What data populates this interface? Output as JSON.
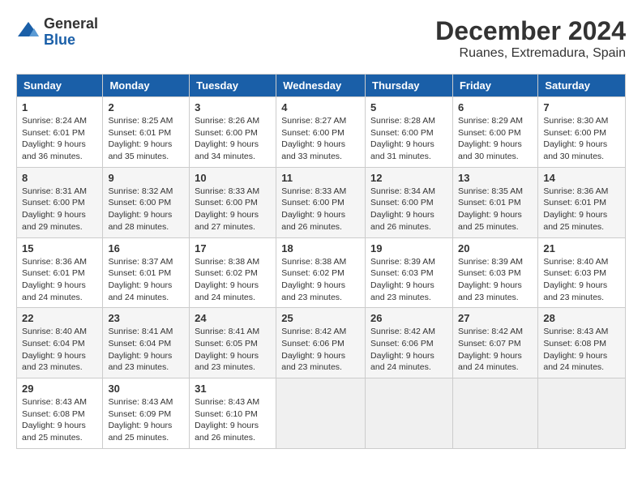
{
  "logo": {
    "general": "General",
    "blue": "Blue"
  },
  "title": {
    "month": "December 2024",
    "location": "Ruanes, Extremadura, Spain"
  },
  "headers": [
    "Sunday",
    "Monday",
    "Tuesday",
    "Wednesday",
    "Thursday",
    "Friday",
    "Saturday"
  ],
  "weeks": [
    [
      {
        "day": "1",
        "sunrise": "8:24 AM",
        "sunset": "6:01 PM",
        "daylight": "9 hours and 36 minutes."
      },
      {
        "day": "2",
        "sunrise": "8:25 AM",
        "sunset": "6:01 PM",
        "daylight": "9 hours and 35 minutes."
      },
      {
        "day": "3",
        "sunrise": "8:26 AM",
        "sunset": "6:00 PM",
        "daylight": "9 hours and 34 minutes."
      },
      {
        "day": "4",
        "sunrise": "8:27 AM",
        "sunset": "6:00 PM",
        "daylight": "9 hours and 33 minutes."
      },
      {
        "day": "5",
        "sunrise": "8:28 AM",
        "sunset": "6:00 PM",
        "daylight": "9 hours and 31 minutes."
      },
      {
        "day": "6",
        "sunrise": "8:29 AM",
        "sunset": "6:00 PM",
        "daylight": "9 hours and 30 minutes."
      },
      {
        "day": "7",
        "sunrise": "8:30 AM",
        "sunset": "6:00 PM",
        "daylight": "9 hours and 30 minutes."
      }
    ],
    [
      {
        "day": "8",
        "sunrise": "8:31 AM",
        "sunset": "6:00 PM",
        "daylight": "9 hours and 29 minutes."
      },
      {
        "day": "9",
        "sunrise": "8:32 AM",
        "sunset": "6:00 PM",
        "daylight": "9 hours and 28 minutes."
      },
      {
        "day": "10",
        "sunrise": "8:33 AM",
        "sunset": "6:00 PM",
        "daylight": "9 hours and 27 minutes."
      },
      {
        "day": "11",
        "sunrise": "8:33 AM",
        "sunset": "6:00 PM",
        "daylight": "9 hours and 26 minutes."
      },
      {
        "day": "12",
        "sunrise": "8:34 AM",
        "sunset": "6:00 PM",
        "daylight": "9 hours and 26 minutes."
      },
      {
        "day": "13",
        "sunrise": "8:35 AM",
        "sunset": "6:01 PM",
        "daylight": "9 hours and 25 minutes."
      },
      {
        "day": "14",
        "sunrise": "8:36 AM",
        "sunset": "6:01 PM",
        "daylight": "9 hours and 25 minutes."
      }
    ],
    [
      {
        "day": "15",
        "sunrise": "8:36 AM",
        "sunset": "6:01 PM",
        "daylight": "9 hours and 24 minutes."
      },
      {
        "day": "16",
        "sunrise": "8:37 AM",
        "sunset": "6:01 PM",
        "daylight": "9 hours and 24 minutes."
      },
      {
        "day": "17",
        "sunrise": "8:38 AM",
        "sunset": "6:02 PM",
        "daylight": "9 hours and 24 minutes."
      },
      {
        "day": "18",
        "sunrise": "8:38 AM",
        "sunset": "6:02 PM",
        "daylight": "9 hours and 23 minutes."
      },
      {
        "day": "19",
        "sunrise": "8:39 AM",
        "sunset": "6:03 PM",
        "daylight": "9 hours and 23 minutes."
      },
      {
        "day": "20",
        "sunrise": "8:39 AM",
        "sunset": "6:03 PM",
        "daylight": "9 hours and 23 minutes."
      },
      {
        "day": "21",
        "sunrise": "8:40 AM",
        "sunset": "6:03 PM",
        "daylight": "9 hours and 23 minutes."
      }
    ],
    [
      {
        "day": "22",
        "sunrise": "8:40 AM",
        "sunset": "6:04 PM",
        "daylight": "9 hours and 23 minutes."
      },
      {
        "day": "23",
        "sunrise": "8:41 AM",
        "sunset": "6:04 PM",
        "daylight": "9 hours and 23 minutes."
      },
      {
        "day": "24",
        "sunrise": "8:41 AM",
        "sunset": "6:05 PM",
        "daylight": "9 hours and 23 minutes."
      },
      {
        "day": "25",
        "sunrise": "8:42 AM",
        "sunset": "6:06 PM",
        "daylight": "9 hours and 23 minutes."
      },
      {
        "day": "26",
        "sunrise": "8:42 AM",
        "sunset": "6:06 PM",
        "daylight": "9 hours and 24 minutes."
      },
      {
        "day": "27",
        "sunrise": "8:42 AM",
        "sunset": "6:07 PM",
        "daylight": "9 hours and 24 minutes."
      },
      {
        "day": "28",
        "sunrise": "8:43 AM",
        "sunset": "6:08 PM",
        "daylight": "9 hours and 24 minutes."
      }
    ],
    [
      {
        "day": "29",
        "sunrise": "8:43 AM",
        "sunset": "6:08 PM",
        "daylight": "9 hours and 25 minutes."
      },
      {
        "day": "30",
        "sunrise": "8:43 AM",
        "sunset": "6:09 PM",
        "daylight": "9 hours and 25 minutes."
      },
      {
        "day": "31",
        "sunrise": "8:43 AM",
        "sunset": "6:10 PM",
        "daylight": "9 hours and 26 minutes."
      },
      null,
      null,
      null,
      null
    ]
  ]
}
